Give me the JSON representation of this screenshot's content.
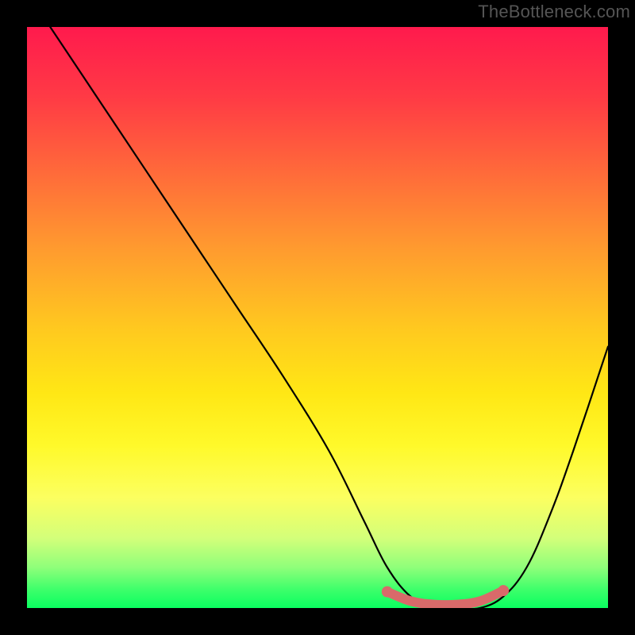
{
  "watermark": "TheBottleneck.com",
  "chart_data": {
    "type": "line",
    "title": "",
    "xlabel": "",
    "ylabel": "",
    "xlim": [
      0,
      100
    ],
    "ylim": [
      0,
      100
    ],
    "grid": false,
    "legend": false,
    "background_gradient": {
      "top_color": "#ff1a4d",
      "bottom_color": "#0aff60",
      "stops": [
        {
          "pos": 0.0,
          "color": "#ff1a4d"
        },
        {
          "pos": 0.12,
          "color": "#ff3a45"
        },
        {
          "pos": 0.25,
          "color": "#ff6a3a"
        },
        {
          "pos": 0.38,
          "color": "#ff9a2f"
        },
        {
          "pos": 0.52,
          "color": "#ffc91f"
        },
        {
          "pos": 0.63,
          "color": "#ffe715"
        },
        {
          "pos": 0.72,
          "color": "#fff92a"
        },
        {
          "pos": 0.81,
          "color": "#fcff60"
        },
        {
          "pos": 0.88,
          "color": "#d3ff7a"
        },
        {
          "pos": 0.93,
          "color": "#8fff7a"
        },
        {
          "pos": 0.97,
          "color": "#3aff6a"
        },
        {
          "pos": 1.0,
          "color": "#0aff60"
        }
      ]
    },
    "series": [
      {
        "name": "bottleneck-curve",
        "color": "#000000",
        "x": [
          4,
          12,
          20,
          28,
          36,
          44,
          52,
          58,
          62,
          66,
          70,
          74,
          78,
          82,
          86,
          90,
          94,
          100
        ],
        "y": [
          100,
          88,
          76,
          64,
          52,
          40,
          27,
          15,
          7,
          2,
          0,
          0,
          0,
          2,
          7,
          16,
          27,
          45
        ]
      }
    ],
    "highlight_segment": {
      "name": "optimal-range",
      "color": "#d96a6a",
      "x": [
        62,
        66,
        70,
        74,
        78,
        82
      ],
      "y": [
        2.8,
        1.2,
        0.6,
        0.6,
        1.2,
        3.0
      ]
    }
  }
}
